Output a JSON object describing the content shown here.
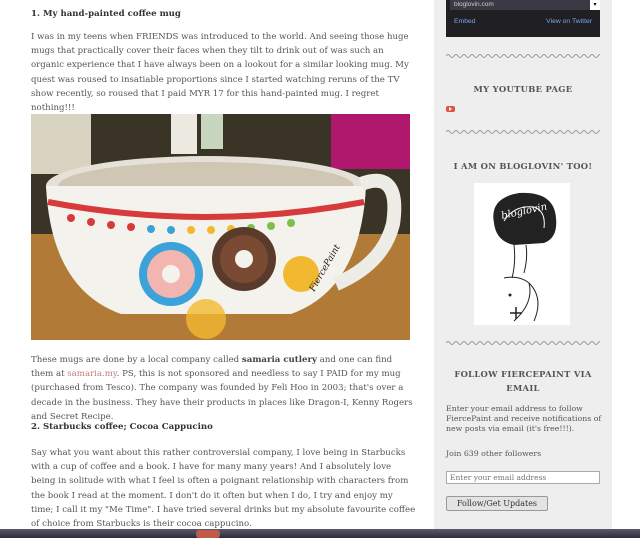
{
  "post": {
    "heading1": "1. My hand-painted coffee mug",
    "para1": "I was in my teens when FRIENDS was introduced to the world. And seeing those huge mugs that practically cover their faces when they tilt to drink out of was such an organic experience that I have always been on a lookout for a similar looking mug. My quest was roused to insatiable proportions since I started watching reruns of the TV show recently, so roused that I paid MYR 17 for this hand-painted mug. I regret nothing!!!",
    "photo_watermark": "FiercePaint",
    "para2_a": "These mugs are done by a local company called ",
    "para2_brand": "samaria cutlery",
    "para2_b": " and one can find them at ",
    "para2_link": "samaria.my",
    "para2_c": ". PS, this is not sponsored and needless to say I PAID for my mug (purchased from Tesco). The company was founded by Feli Hoo in 2003; that's over a decade in the business. They have their products in places like Dragon-I, Kenny Rogers and Secret Recipe.",
    "heading2": "2. Starbucks coffee; Cocoa Cappucino",
    "para3": "Say what you want about this rather controversial company, I love being in Starbucks with a cup of coffee and a book. I have for many many years! And I absolutely love being in solitude with what I feel is often a poignant relationship with characters from the book I read at the moment. I don't do it often but when I do, I try and enjoy my time; I call it my \"Me Time\". I have tried several drinks but my absolute favourite coffee of choice from Starbucks is their cocoa cappucino."
  },
  "sidebar": {
    "twitter": {
      "account": "bloglovin.com",
      "embed": "Embed",
      "view": "View on Twitter"
    },
    "youtube_title": "MY YOUTUBE PAGE",
    "bloglovin_title": "I AM ON BLOGLOVIN' TOO!",
    "bloglovin_logo_text": "bloglovin",
    "follow_title_1": "FOLLOW FIERCEPAINT VIA",
    "follow_title_2": "EMAIL",
    "follow_desc": "Enter your email address to follow FiercePaint and receive notifications of new posts via email (it's free!!!).",
    "followers": "Join 639 other followers",
    "email_placeholder": "Enter your email address",
    "follow_button": "Follow/Get Updates"
  },
  "colors": {
    "link": "#c67b7b",
    "sidebar_bg": "#eeeeee",
    "youtube_red": "#e0533d",
    "twitter_bg": "#1f1f24"
  }
}
